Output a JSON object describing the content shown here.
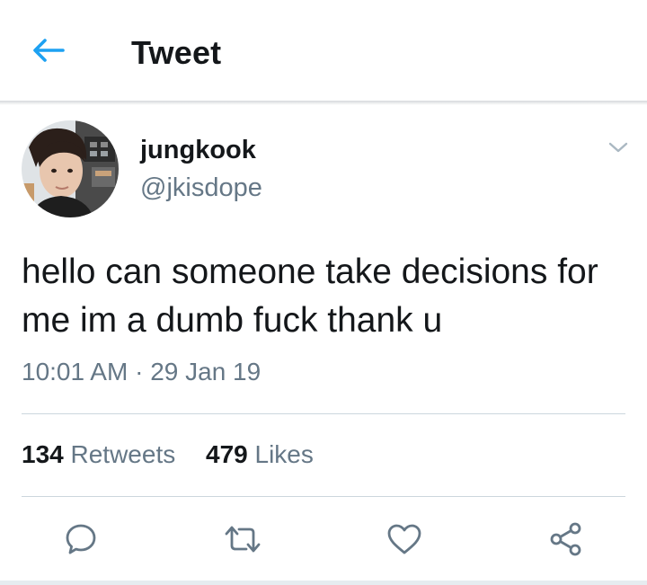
{
  "header": {
    "title": "Tweet",
    "back_icon": "arrow-left-icon"
  },
  "tweet": {
    "author": {
      "display_name": "jungkook",
      "handle": "@jkisdope"
    },
    "text": "hello can someone take decisions for me im a dumb fuck thank u",
    "time": "10:01 AM",
    "separator": "·",
    "date": "29 Jan 19",
    "stats": {
      "retweets": {
        "count": "134",
        "label": "Retweets"
      },
      "likes": {
        "count": "479",
        "label": "Likes"
      }
    },
    "actions": [
      "reply-icon",
      "retweet-icon",
      "like-icon",
      "share-icon"
    ]
  },
  "colors": {
    "accent": "#1da1f2",
    "text_primary": "#14171a",
    "text_secondary": "#657786",
    "divider": "#ccd6dd"
  }
}
